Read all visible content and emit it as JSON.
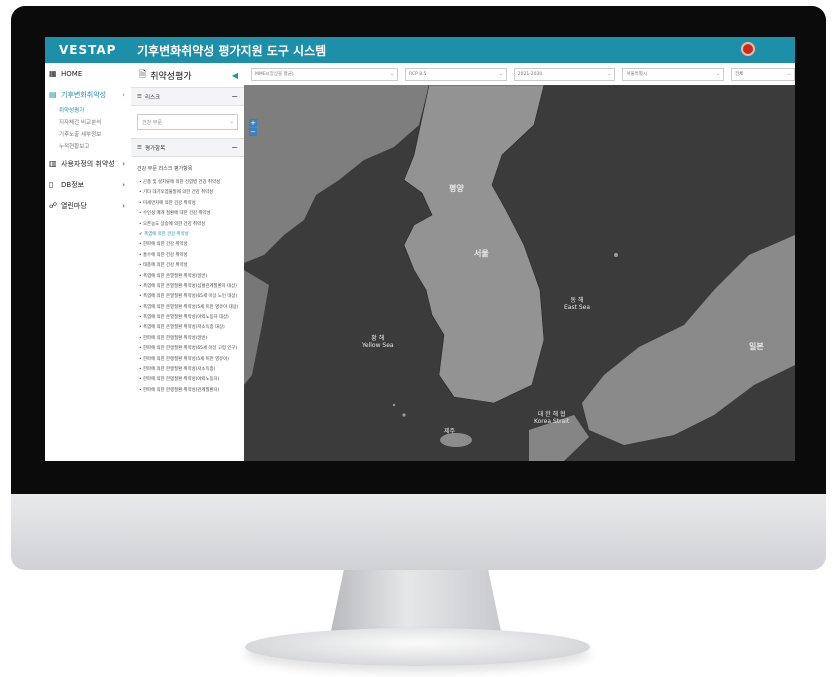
{
  "app": {
    "logo": "VESTAP",
    "title": "기후변화취약성 평가지원 도구 시스템"
  },
  "nav": {
    "items": [
      {
        "label": "HOME"
      },
      {
        "label": "기후변화취약성",
        "arrow": "›"
      },
      {
        "label": "사용자정의 취약성",
        "arrow": "›"
      },
      {
        "label": "DB정보",
        "arrow": "›"
      },
      {
        "label": "열린마당",
        "arrow": "›"
      }
    ],
    "subitems": [
      "취약성평가",
      "지자체간 비교분석",
      "기후노출 세부정보",
      "누적현황보고"
    ]
  },
  "panel": {
    "title": "취약성평가",
    "toggle": "◀",
    "risk_section": "리스크",
    "risk_select": "건강 부문",
    "eval_section": "평가항목",
    "eval_desc": "건강 부문 리스크 평가항목",
    "items": [
      "곤충 및 설치류에 의한 전염병 건강 취약성",
      "기타 대기오염물질에 의한 건강 취약성",
      "미세먼지에 의한 건강 취약성",
      "수인성 매개 질환에 대한 건강 취약성",
      "오존농도 상승에 의한 건강 취약성",
      "폭염에 의한 건강 취약성",
      "한파에 의한 건강 취약성",
      "홍수에 의한 건강 취약성",
      "태풍에 의한 건강 취약성",
      "폭염에 의한 온열질환 취약성(일반)",
      "폭염에 의한 온열질환 취약성(심혈관계질환자 대상)",
      "폭염에 의한 온열질환 취약성(65세 이상 노인 대상)",
      "폭염에 의한 온열질환 취약성(5세 미만 영유아 대상)",
      "폭염에 의한 온열질환 취약성(야외노동자 대상)",
      "폭염에 의한 온열질환 취약성(저소득층 대상)",
      "한파에 의한 한랭질환 취약성(일반)",
      "한파에 의한 한랭질환 취약성(65세 이상 고령 인구)",
      "한파에 의한 한랭질환 취약성(5세 미만 영유아)",
      "한파에 의한 한랭질환 취약성(저소득층)",
      "한파에 의한 한랭질환 취약성(야외노동자)",
      "한파에 의한 한랭질환 취약성(관계질환자)"
    ],
    "selected_index": 5
  },
  "filters": [
    {
      "value": "MMEs(앙상블 평균)"
    },
    {
      "value": "RCP 8.5"
    },
    {
      "value": "2021-2030"
    },
    {
      "value": "서울특별시"
    },
    {
      "value": "전체"
    }
  ],
  "map": {
    "labels": {
      "yellow_sea": "황 해\nYellow Sea",
      "east_sea": "동 해\nEast Sea",
      "korea_strait": "대 한 해 협\nKorea Strait",
      "japan": "일본",
      "pyongyang": "평양",
      "seoul": "서울",
      "jeju": "제주"
    },
    "zoom_in": "+",
    "zoom_out": "−"
  },
  "colors": {
    "accent": "#1e8fa8",
    "map_sea": "#3b3b3b",
    "map_land": "#8a8a8a"
  }
}
